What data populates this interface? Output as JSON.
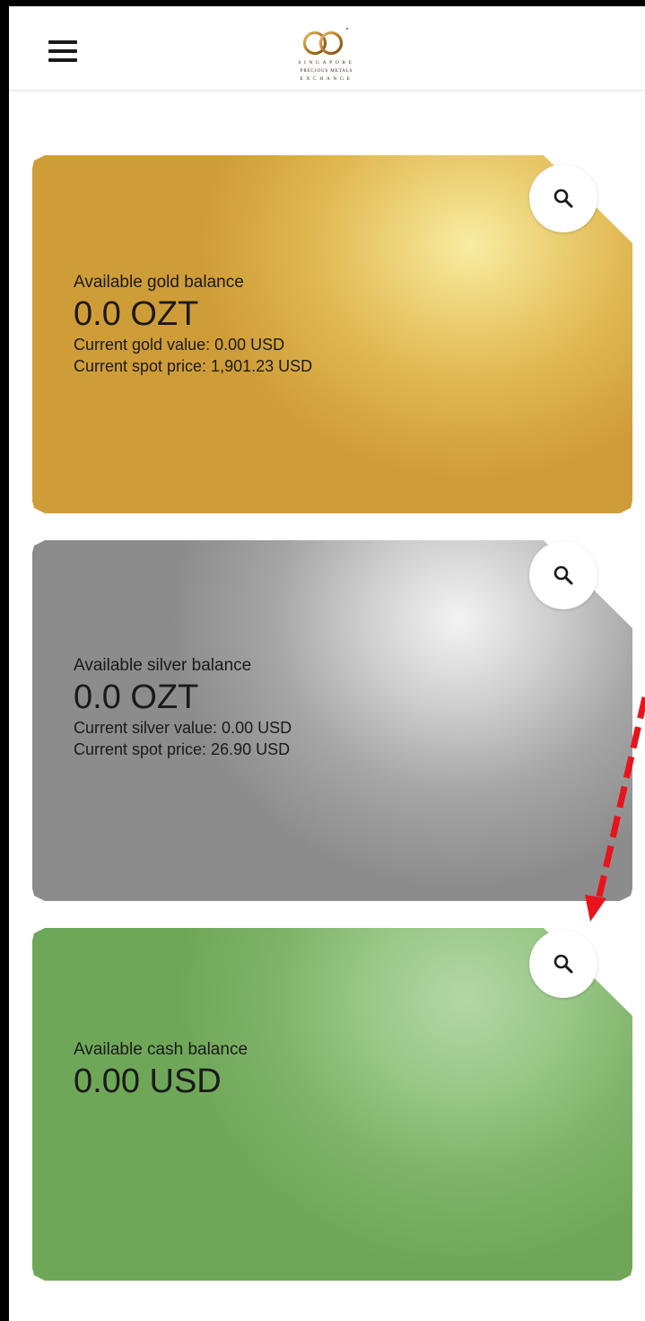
{
  "header": {
    "menu_icon": "hamburger-menu-icon",
    "logo": {
      "line1": "SINGAPORE",
      "line2": "PRECIOUS METALS",
      "line3": "EXCHANGE",
      "color": "#b07a2a"
    }
  },
  "cards": {
    "gold": {
      "label": "Available gold balance",
      "amount": "0.0 OZT",
      "value_line": "Current gold value: 0.00 USD",
      "spot_line": "Current spot price: 1,901.23 USD",
      "color": "#dfb54e"
    },
    "silver": {
      "label": "Available silver balance",
      "amount": "0.0 OZT",
      "value_line": "Current silver value: 0.00 USD",
      "spot_line": "Current spot price: 26.90 USD",
      "color": "#a5a5a5"
    },
    "cash": {
      "label": "Available cash balance",
      "amount": "0.00 USD",
      "color": "#8fc07c"
    }
  },
  "search_icon": "search-icon",
  "annotation": {
    "arrow_color": "#e8131b",
    "style": "dashed"
  }
}
